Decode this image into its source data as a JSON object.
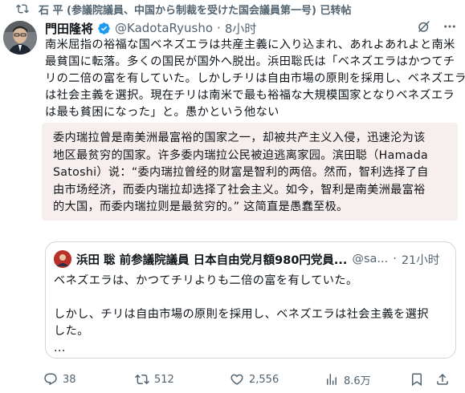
{
  "repost": {
    "text": "石 平 (参議院議員、中国から制裁を受けた国会議員第一号) 已转帖",
    "icon": "repost-icon"
  },
  "author": {
    "name": "門田隆将",
    "handle": "@KadotaRyusho",
    "separator": "·",
    "time": "8小时"
  },
  "post": {
    "lines": [
      "南米屈指の裕福な国ベネズエラは共産主義に入り込まれ、あれよあれよと南米",
      "最貧国に転落。多くの国民が国外へ脱出。浜田聡氏は「ベネズエラはかつてチ",
      "リの二倍の富を有していた。しかしチリは自由市場の原則を採用し、ベネズエラ",
      "は社会主義を選択。現在チリは南米で最も裕福な大規模国家となりベネズエラ",
      "は最も貧困になった」と。愚かという他ない"
    ]
  },
  "translation": {
    "lines": [
      "委内瑞拉曾是南美洲最富裕的国家之一，却被共产主义入侵，迅速沦为该",
      "地区最贫穷的国家。许多委内瑞拉公民被迫逃离家园。滨田聪（Hamada",
      "Satoshi）说：“委内瑞拉曾经的财富是智利的两倍。然而，智利选择了自",
      "由市场经济，而委内瑞拉却选择了社会主义。如今，智利是南美洲最富裕",
      "的大国，而委内瑞拉则是最贫穷的。” 这简直是愚蠢至极。"
    ]
  },
  "quote": {
    "name": "浜田 聡 前参議院議員 日本自由党月額980円党員...",
    "handle": "@sa...",
    "separator": "·",
    "time": "21小时",
    "lines": [
      "ベネズエラは、かつてチリよりも二倍の富を有していた。",
      "",
      "しかし、チリは自由市場の原則を採用し、ベネズエラは社会主義を選択",
      "した。",
      "..."
    ]
  },
  "actions": {
    "replies": "38",
    "reposts": "512",
    "likes": "2,556",
    "views": "8.6万"
  },
  "colors": {
    "text": "#0f1419",
    "muted": "#536471",
    "verified": "#1d9bf0",
    "translation_bg": "#f7eeee",
    "border": "#cfd9de"
  }
}
